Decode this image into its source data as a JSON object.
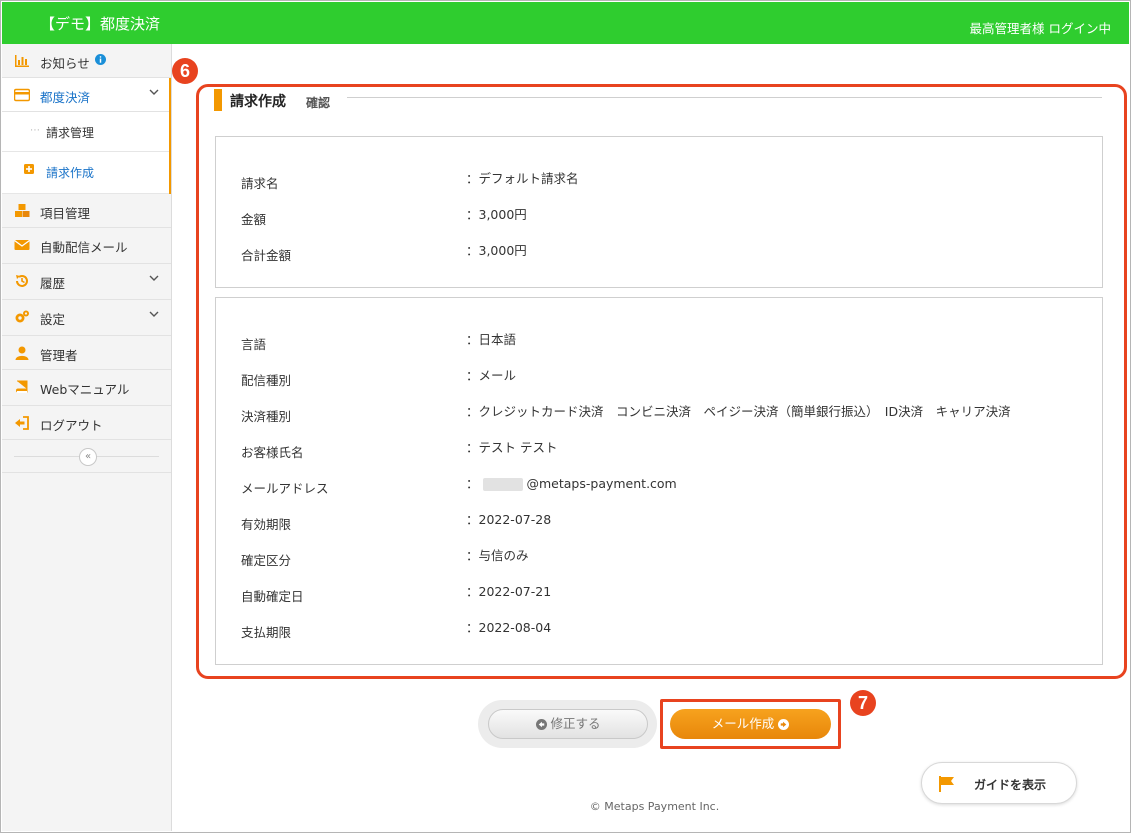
{
  "header": {
    "app_title": "【デモ】都度決済",
    "user_status": "最高管理者様 ログイン中",
    "bg_color": "#2fcd2f"
  },
  "sidebar": {
    "items": [
      {
        "label": "お知らせ",
        "icon": "chart-bar-icon",
        "badge_icon": "info-icon"
      },
      {
        "label": "都度決済",
        "icon": "credit-card-icon",
        "active": true,
        "chevron": "chevron-down-icon"
      },
      {
        "label": "請求管理",
        "sub": true
      },
      {
        "label": "請求作成",
        "sub": true,
        "current": true,
        "icon": "plus-square-icon"
      },
      {
        "label": "項目管理",
        "icon": "cubes-icon"
      },
      {
        "label": "自動配信メール",
        "icon": "envelope-icon"
      },
      {
        "label": "履歴",
        "icon": "history-icon",
        "chevron": "chevron-down-icon"
      },
      {
        "label": "設定",
        "icon": "gears-icon",
        "chevron": "chevron-down-icon"
      },
      {
        "label": "管理者",
        "icon": "user-icon"
      },
      {
        "label": "Webマニュアル",
        "icon": "book-icon"
      },
      {
        "label": "ログアウト",
        "icon": "sign-out-icon"
      }
    ],
    "collapse_label": "«"
  },
  "annotations": {
    "callout_6": "6",
    "callout_7": "7",
    "highlight_color": "#e8431f"
  },
  "section": {
    "title": "請求作成",
    "subtitle": "確認",
    "accent_color": "#f39800"
  },
  "summary": [
    {
      "label": "請求名",
      "value": "：デフォルト請求名"
    },
    {
      "label": "金額",
      "value": "：3,000円"
    },
    {
      "label": "合計金額",
      "value": "：3,000円"
    }
  ],
  "details": [
    {
      "label": "言語",
      "value": "：日本語"
    },
    {
      "label": "配信種別",
      "value": "：メール"
    },
    {
      "label": "決済種別",
      "value": "：クレジットカード決済　コンビニ決済　ペイジー決済（簡単銀行振込）　ID決済　キャリア決済"
    },
    {
      "label": "お客様氏名",
      "value": "：テスト テスト"
    },
    {
      "label": "メールアドレス",
      "value": "：",
      "value_suffix": "@metaps-payment.com"
    },
    {
      "label": "有効期限",
      "value": "：2022-07-28"
    },
    {
      "label": "確定区分",
      "value": "：与信のみ"
    },
    {
      "label": "自動確定日",
      "value": "：2022-07-21"
    },
    {
      "label": "支払期限",
      "value": "：2022-08-04"
    }
  ],
  "buttons": {
    "fix_label": "修正する",
    "mail_label": "メール作成",
    "guide_label": "ガイドを表示"
  },
  "footer": {
    "copyright": "© Metaps Payment Inc."
  }
}
